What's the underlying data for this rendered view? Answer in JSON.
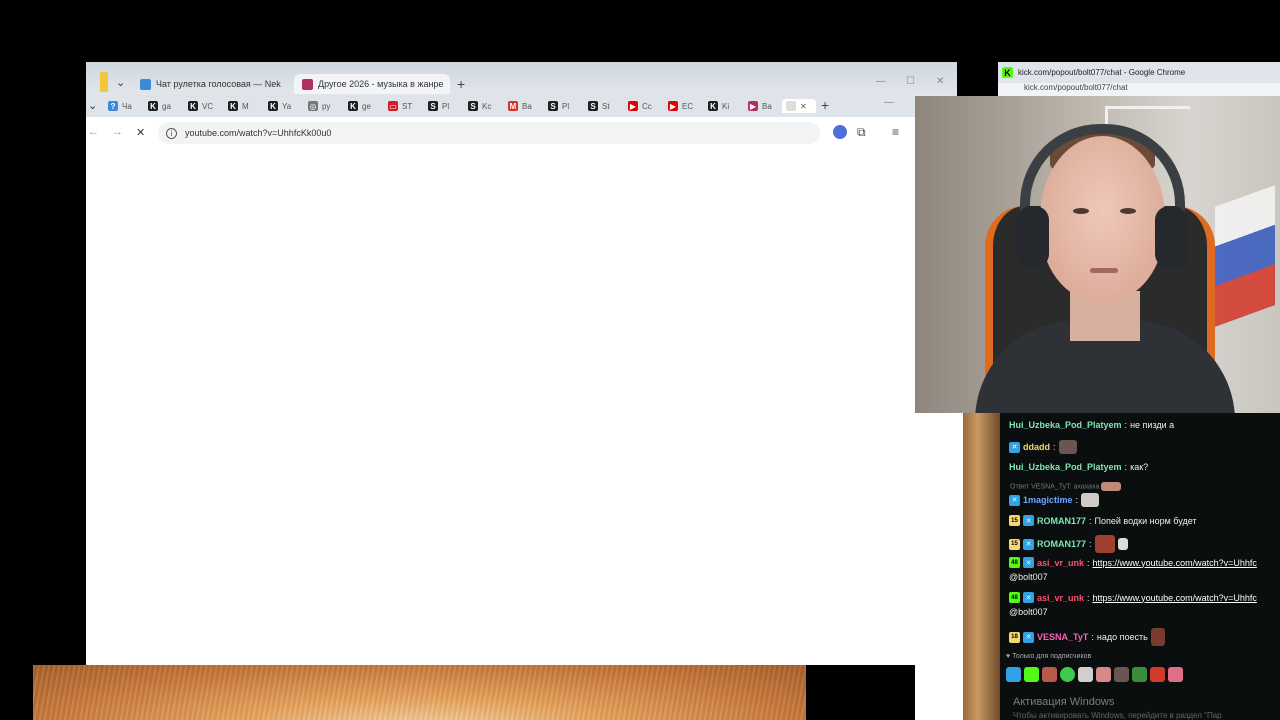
{
  "back_browser": {
    "tabs": [
      {
        "label": "Чат рулетка голосовая — Nek",
        "favicon_color": "#3c8bd9"
      },
      {
        "label": "Другое 2026 - музыка в жанре",
        "favicon_color": "#b0305e"
      }
    ],
    "close_glyph": "✕",
    "new_tab": "+",
    "minimize": "—",
    "maximize": "☐",
    "close": "✕"
  },
  "front_browser": {
    "tab_list_glyph": "⌄",
    "mini_tabs": [
      {
        "label": "Ча",
        "fav": "?",
        "color": "#3c8bd9"
      },
      {
        "label": "ga",
        "fav": "K",
        "color": "#1f1f1f"
      },
      {
        "label": "VC",
        "fav": "K",
        "color": "#1f1f1f"
      },
      {
        "label": "M",
        "fav": "K",
        "color": "#1f1f1f"
      },
      {
        "label": "Ya",
        "fav": "K",
        "color": "#1f1f1f"
      },
      {
        "label": "ру",
        "fav": "◎",
        "color": "#777777"
      },
      {
        "label": "ge",
        "fav": "K",
        "color": "#1f1f1f"
      },
      {
        "label": "ST",
        "fav": "▭",
        "color": "#d11c2a"
      },
      {
        "label": "Pl",
        "fav": "S",
        "color": "#1f1f1f"
      },
      {
        "label": "Kc",
        "fav": "S",
        "color": "#1f1f1f"
      },
      {
        "label": "Ba",
        "fav": "M",
        "color": "#d93025"
      },
      {
        "label": "Pl",
        "fav": "S",
        "color": "#1f1f1f"
      },
      {
        "label": "St",
        "fav": "S",
        "color": "#1f1f1f"
      },
      {
        "label": "Cc",
        "fav": "▶",
        "color": "#e00000"
      },
      {
        "label": "EC",
        "fav": "▶",
        "color": "#e00000"
      },
      {
        "label": "Ki",
        "fav": "K",
        "color": "#1f1f1f"
      },
      {
        "label": "Ba",
        "fav": "▶",
        "color": "#b0305e"
      }
    ],
    "active_tab_close": "✕",
    "new_tab": "+",
    "minimize": "—",
    "back": "←",
    "forward": "→",
    "reload": "✕",
    "url": "youtube.com/watch?v=UhhfcKk00u0",
    "extension_icons": [
      "extension-blue-icon",
      "puzzle-icon",
      "queue-icon"
    ]
  },
  "chat_window": {
    "title": "kick.com/popout/bolt077/chat - Google Chrome",
    "url": "kick.com/popout/bolt077/chat",
    "messages": [
      {
        "type": "text",
        "user": "Hui_Uzbeka_Pod_Platyem",
        "user_color": "#7ee8b0",
        "text": "не пизди а"
      },
      {
        "type": "emote",
        "user": "ddadd",
        "user_color": "#f5d76e",
        "kick": true
      },
      {
        "type": "text",
        "user": "Hui_Uzbeka_Pod_Platyem",
        "user_color": "#7ee8b0",
        "text": "как?"
      },
      {
        "type": "reply",
        "text": "Ответ VESNA_TyT: ахахаха"
      },
      {
        "type": "emote",
        "user": "1magictime",
        "user_color": "#6aa8ff",
        "kick": true
      },
      {
        "type": "text",
        "user": "ROMAN177",
        "user_color": "#7ee8b0",
        "sub": "15",
        "sub_color": "#f5d76e",
        "kick": true,
        "text": "Попей водки норм будет"
      },
      {
        "type": "emote",
        "user": "ROMAN177",
        "user_color": "#7ee8b0",
        "sub": "15",
        "sub_color": "#f5d76e",
        "kick": true
      },
      {
        "type": "link",
        "user": "asi_vr_unk",
        "user_color": "#ff4d6d",
        "sub": "48",
        "sub_color": "#53fc18",
        "kick": true,
        "link": "https://www.youtube.com/watch?v=Uhhfc",
        "mention": "@bolt007"
      },
      {
        "type": "link",
        "user": "asi_vr_unk",
        "user_color": "#ff4d6d",
        "sub": "48",
        "sub_color": "#53fc18",
        "kick": true,
        "link": "https://www.youtube.com/watch?v=Uhhfc",
        "mention": "@bolt007"
      },
      {
        "type": "text",
        "user": "VESNA_TyT",
        "user_color": "#ff5fb4",
        "sub": "18",
        "sub_color": "#f5d76e",
        "kick": true,
        "text": "надо поесть"
      }
    ],
    "subscribers_only": "Только для подписчиков",
    "heart_glyph": "♥",
    "kick_glyph": "✕",
    "windows_activate": "Активация Windows",
    "windows_activate_sub": "Чтобы активировать Windows, перейдите в раздел \"Пар"
  }
}
